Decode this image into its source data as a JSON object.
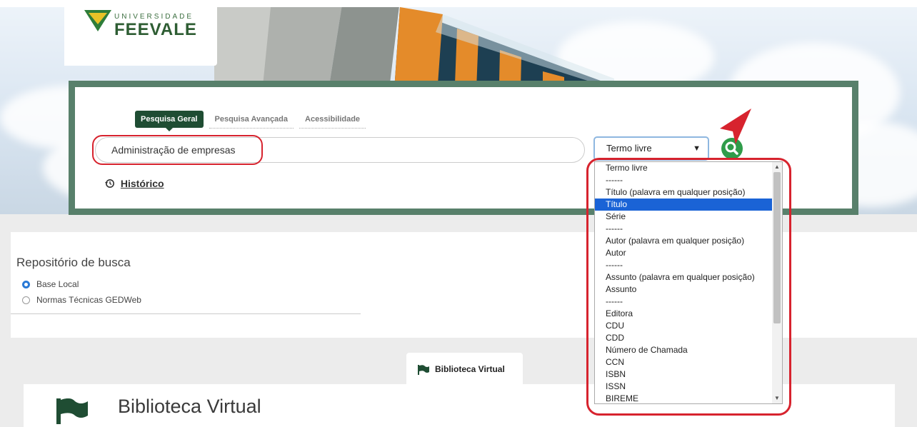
{
  "logo": {
    "small": "UNIVERSIDADE",
    "big": "FEEVALE"
  },
  "tabs": [
    {
      "label": "Pesquisa Geral"
    },
    {
      "label": "Pesquisa Avançada"
    },
    {
      "label": "Acessibilidade"
    }
  ],
  "search": {
    "value": "Administração de empresas",
    "history_label": "Histórico"
  },
  "select": {
    "selected": "Termo livre",
    "options": [
      "Termo livre",
      "------",
      "Título (palavra em qualquer posição)",
      "Título",
      "Série",
      "------",
      "Autor (palavra em qualquer posição)",
      "Autor",
      "------",
      "Assunto (palavra em qualquer posição)",
      "Assunto",
      "------",
      "Editora",
      "CDU",
      "CDD",
      "Número de Chamada",
      "CCN",
      "ISBN",
      "ISSN",
      "BIREME"
    ],
    "highlighted": "Título"
  },
  "repo": {
    "title": "Repositório de busca",
    "options": [
      {
        "label": "Base Local",
        "checked": true
      },
      {
        "label": "Normas Técnicas GEDWeb",
        "checked": false
      }
    ]
  },
  "virtual": {
    "tab_label": "Biblioteca Virtual",
    "title": "Biblioteca Virtual"
  },
  "colors": {
    "brand_green": "#1f4d33",
    "panel_border": "#58806b",
    "search_button": "#2f9c4a",
    "annotation_red": "#d7232e",
    "selection_blue": "#1a63d6"
  },
  "icons": [
    "search-icon",
    "history-icon",
    "flag-icon",
    "chevron-down-icon",
    "arrow-annotation-icon"
  ]
}
